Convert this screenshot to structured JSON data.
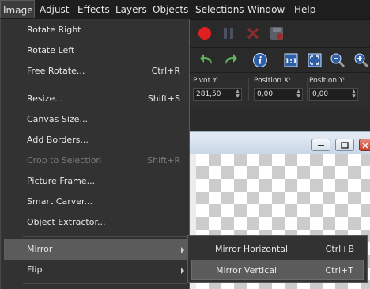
{
  "menubar": [
    {
      "label": "Image",
      "active": true
    },
    {
      "label": "Adjust"
    },
    {
      "label": "Effects"
    },
    {
      "label": "Layers"
    },
    {
      "label": "Objects"
    },
    {
      "label": "Selections"
    },
    {
      "label": "Window"
    },
    {
      "label": "Help"
    }
  ],
  "image_menu": {
    "items": [
      {
        "label": "Rotate Right",
        "shortcut": ""
      },
      {
        "label": "Rotate Left",
        "shortcut": ""
      },
      {
        "label": "Free Rotate...",
        "shortcut": "Ctrl+R"
      },
      {
        "label": "Resize...",
        "shortcut": "Shift+S"
      },
      {
        "label": "Canvas Size...",
        "shortcut": ""
      },
      {
        "label": "Add Borders...",
        "shortcut": ""
      },
      {
        "label": "Crop to Selection",
        "shortcut": "Shift+R",
        "disabled": true
      },
      {
        "label": "Picture Frame...",
        "shortcut": ""
      },
      {
        "label": "Smart Carver...",
        "shortcut": ""
      },
      {
        "label": "Object Extractor...",
        "shortcut": ""
      },
      {
        "label": "Mirror",
        "shortcut": "",
        "submenu": true,
        "highlight": true
      },
      {
        "label": "Flip",
        "shortcut": "",
        "submenu": true
      }
    ]
  },
  "mirror_submenu": {
    "items": [
      {
        "label": "Mirror Horizontal",
        "shortcut": "Ctrl+B"
      },
      {
        "label": "Mirror Vertical",
        "shortcut": "Ctrl+T",
        "highlight": true
      }
    ]
  },
  "properties": {
    "pivot_y_label": "Pivot Y:",
    "pivot_y_value": "281,50",
    "position_x_label": "Position X:",
    "position_x_value": "0,00",
    "position_y_label": "Position Y:",
    "position_y_value": "0,00"
  },
  "toolbar_icons": [
    "record-icon",
    "pause-icon",
    "stop-icon",
    "save-icon",
    "undo-icon",
    "redo-icon",
    "info-icon",
    "actual-size-icon",
    "fit-icon",
    "zoom-out-icon",
    "zoom-in-icon"
  ],
  "colors": {
    "menu_bg": "#323232",
    "highlight": "#5b5b5b",
    "accent_red": "#e02020"
  }
}
